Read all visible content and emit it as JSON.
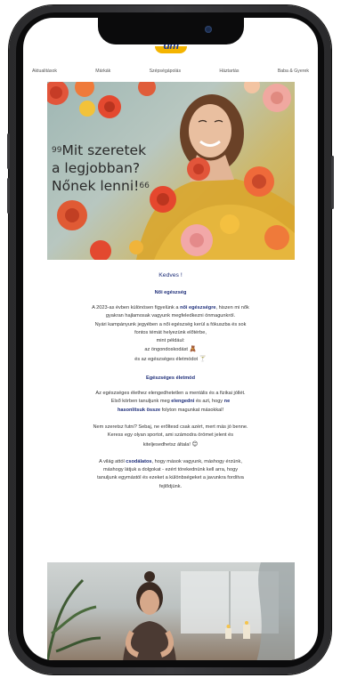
{
  "brand": {
    "logo_text": "dm"
  },
  "nav": {
    "items": [
      {
        "label": "Aktualitások"
      },
      {
        "label": "Márkák"
      },
      {
        "label": "Szépségápolás"
      },
      {
        "label": "Háztartás"
      },
      {
        "label": "Baba & Gyerek"
      }
    ]
  },
  "hero": {
    "quote_open": "99",
    "quote_line1": "Mit szeretek",
    "quote_line2": "a legjobban?",
    "quote_line3": "Nőnek lenni!",
    "quote_close": "66"
  },
  "email": {
    "greeting": "Kedves !",
    "section1_title": "Női egészség",
    "p1": {
      "a": "A 2023-as évben különösen figyelünk a ",
      "a_bold": "női egészségre",
      "a2": ", hiszen mi nők",
      "b": "gyakran hajlamosak vagyunk megfeledkezni önmagunkról.",
      "c": "Nyári kampányunk jegyében a női egészség kerül a fókuszba és sok",
      "d": "fontos témát helyezünk előtérbe,",
      "e": "mint például:",
      "f": "az öngondoskodást",
      "f_emoji": "🧸",
      "g": "és az egészséges életmódot",
      "g_emoji": "🍸"
    },
    "section2_title": "Egészséges életmód",
    "p2": {
      "a": "Az egészséges élethez elengedhetetlen a mentális és a fizikai jóllét.",
      "b": "Első körben tanuljunk meg ",
      "b_bold": "elengedni",
      "b2": " és azt, hogy ",
      "b_bold2": "ne",
      "c_bold": "hasonlítsuk össze",
      "c": " folyton magunkat másokkal!"
    },
    "p3": {
      "a": "Nem szeretsz futni? Sebaj, ne erőltesd csak azért, mert más jó benne.",
      "b": "Keress egy olyan sportot, ami számodra örömet jelent és",
      "c": "kiteljesedhetsz általa!",
      "c_emoji": "😊"
    },
    "p4": {
      "a": "A világ attól ",
      "a_bold": "csodálatos",
      "a2": ", hogy mások vagyunk, máshogy érzünk,",
      "b": "máshogy látjuk a dolgokat - ezért törekednünk kell arra, hogy",
      "c": "tanuljunk egymástól és ezeket a különbségeket a javunkra fordítva",
      "d": "fejlődjünk."
    }
  },
  "colors": {
    "accent": "#1f2f7a",
    "logo_yellow": "#f4b400",
    "text": "#333333"
  }
}
